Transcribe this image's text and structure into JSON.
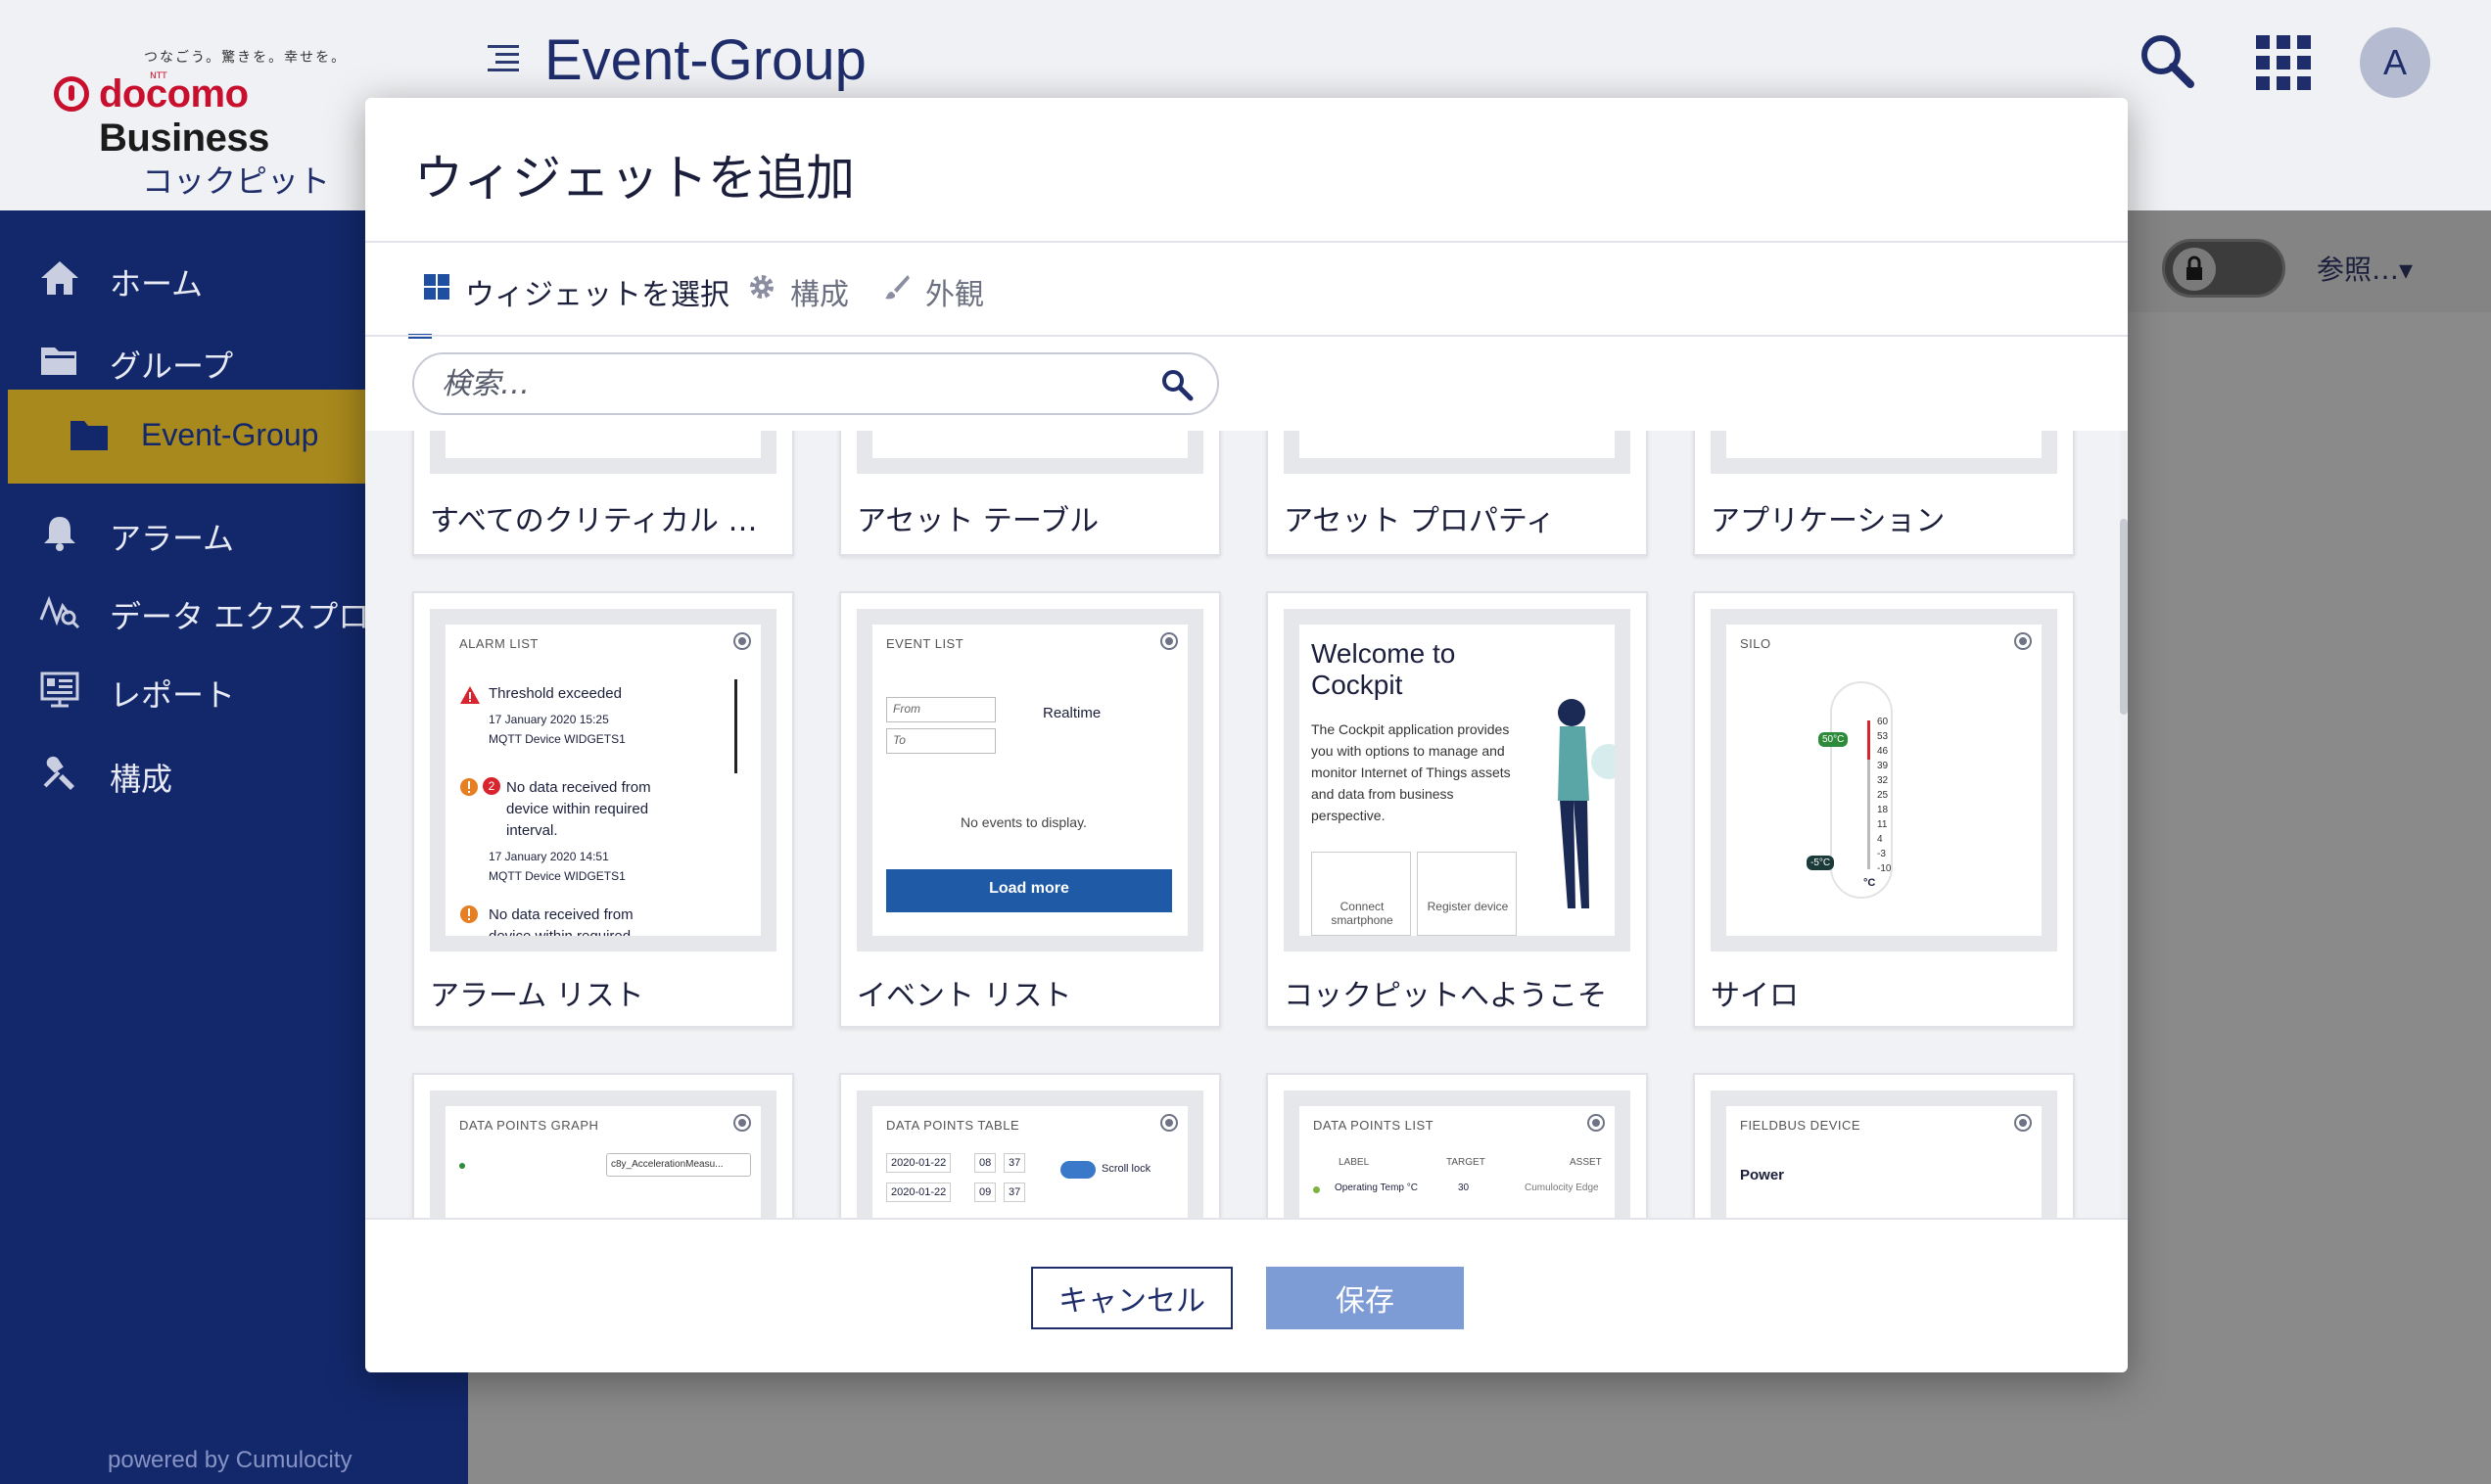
{
  "header": {
    "tagline": "つなごう。驚きを。幸せを。",
    "brand_small": "NTT",
    "brand": "docomo",
    "brand_suffix": "Business",
    "app_title": "Event-Group",
    "avatar_initial": "A",
    "app_name": "コックピット"
  },
  "sidebar": {
    "items": [
      {
        "label": "ホーム",
        "icon": "home-icon"
      },
      {
        "label": "グループ",
        "icon": "folder-open-icon"
      },
      {
        "label": "Event-Group",
        "icon": "folder-icon"
      },
      {
        "label": "アラーム",
        "icon": "bell-icon"
      },
      {
        "label": "データ エクスプロ",
        "icon": "data-explorer-icon"
      },
      {
        "label": "レポート",
        "icon": "report-icon"
      },
      {
        "label": "構成",
        "icon": "configuration-icon"
      }
    ],
    "powered_by": "powered by Cumulocity"
  },
  "toolbar": {
    "reference_label": "参照…▾"
  },
  "modal": {
    "title": "ウィジェットを追加",
    "tabs": [
      {
        "label": "ウィジェットを選択",
        "icon": "grid-icon"
      },
      {
        "label": "構成",
        "icon": "gear-icon"
      },
      {
        "label": "外観",
        "icon": "brush-icon"
      }
    ],
    "search_placeholder": "検索…",
    "widgets_row1": [
      "すべてのクリティカル ア…",
      "アセット テーブル",
      "アセット プロパティ",
      "アプリケーション"
    ],
    "widgets_row2": [
      "アラーム リスト",
      "イベント リスト",
      "コックピットへようこそ",
      "サイロ"
    ],
    "previews": {
      "alarm": {
        "title": "ALARM LIST",
        "a1": "Threshold exceeded",
        "a1_date": "17 January 2020 15:25",
        "a1_device": "MQTT Device WIDGETS1",
        "a2_count": "2",
        "a2": "No data received from device within required interval.",
        "a2_date": "17 January 2020 14:51",
        "a2_device": "MQTT Device WIDGETS1",
        "a3": "No data received from",
        "a3_cut": "device within required"
      },
      "event": {
        "title": "EVENT LIST",
        "from": "From",
        "to": "To",
        "realtime": "Realtime",
        "empty": "No events to display.",
        "load_more": "Load more"
      },
      "welcome": {
        "title": "Welcome to Cockpit",
        "body": "The Cockpit application provides you with options to manage and monitor Internet of Things assets and data from business perspective.",
        "b1": "Connect smartphone",
        "b2": "Register device"
      },
      "silo": {
        "title": "SILO",
        "high": "50°C",
        "low": "-5°C",
        "unit": "°C",
        "scale": [
          "60",
          "53",
          "46",
          "39",
          "32",
          "25",
          "18",
          "11",
          "4",
          "-3",
          "-10"
        ]
      },
      "graph": {
        "title": "DATA POINTS GRAPH",
        "select": "c8y_AccelerationMeasu..."
      },
      "table": {
        "title": "DATA POINTS TABLE",
        "d1": "2020-01-22",
        "t1h": "08",
        "t1m": "37",
        "d2": "2020-01-22",
        "t2h": "09",
        "t2m": "37",
        "scroll": "Scroll lock"
      },
      "list": {
        "title": "DATA POINTS LIST",
        "c1": "LABEL",
        "c2": "TARGET",
        "c3": "ASSET",
        "r1": "Operating Temp °C",
        "r1v": "30",
        "r1a": "Cumulocity Edge"
      },
      "fieldbus": {
        "title": "FIELDBUS DEVICE",
        "power": "Power"
      }
    },
    "cancel_label": "キャンセル",
    "save_label": "保存"
  },
  "colors": {
    "sidebar": "#13286b",
    "active_nav": "#a8891d",
    "accent": "#1f4fa3",
    "save_button": "#7d9bd4",
    "alarm_red": "#d9232d",
    "alarm_orange": "#e67e22"
  }
}
